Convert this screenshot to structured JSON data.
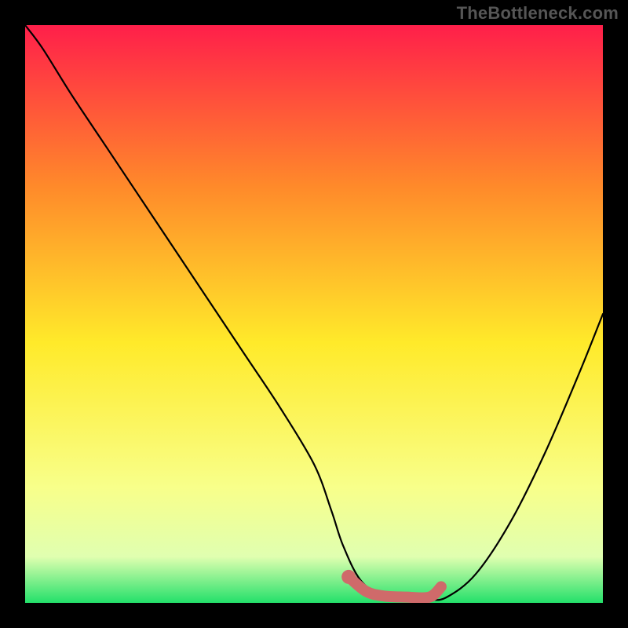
{
  "watermark": "TheBottleneck.com",
  "colors": {
    "frame": "#000000",
    "gradient_top": "#ff1f4a",
    "gradient_mid_upper": "#ff8a2a",
    "gradient_mid": "#ffea2a",
    "gradient_lower": "#f8ff8a",
    "gradient_pale": "#e0ffb0",
    "gradient_bottom": "#23e06a",
    "curve": "#000000",
    "marker": "#cf6a6a"
  },
  "chart_data": {
    "type": "line",
    "title": "",
    "xlabel": "",
    "ylabel": "",
    "xlim": [
      0,
      100
    ],
    "ylim": [
      0,
      100
    ],
    "series": [
      {
        "name": "bottleneck-curve",
        "x": [
          0,
          3,
          8,
          14,
          20,
          26,
          32,
          38,
          44,
          50,
          53,
          55,
          58,
          62,
          66,
          70,
          73,
          78,
          84,
          90,
          96,
          100
        ],
        "y": [
          100,
          96,
          88,
          79,
          70,
          61,
          52,
          43,
          34,
          24,
          16,
          10,
          4,
          1,
          0.5,
          0.5,
          1,
          5,
          14,
          26,
          40,
          50
        ]
      }
    ],
    "annotations": [
      {
        "name": "optimal-range-marker",
        "type": "segment",
        "x": [
          56,
          59,
          62,
          66,
          70,
          72
        ],
        "y": [
          4.5,
          2.0,
          1.2,
          1.0,
          1.0,
          2.8
        ]
      },
      {
        "name": "optimal-point-marker",
        "type": "point",
        "x": 56,
        "y": 4.5
      }
    ]
  }
}
